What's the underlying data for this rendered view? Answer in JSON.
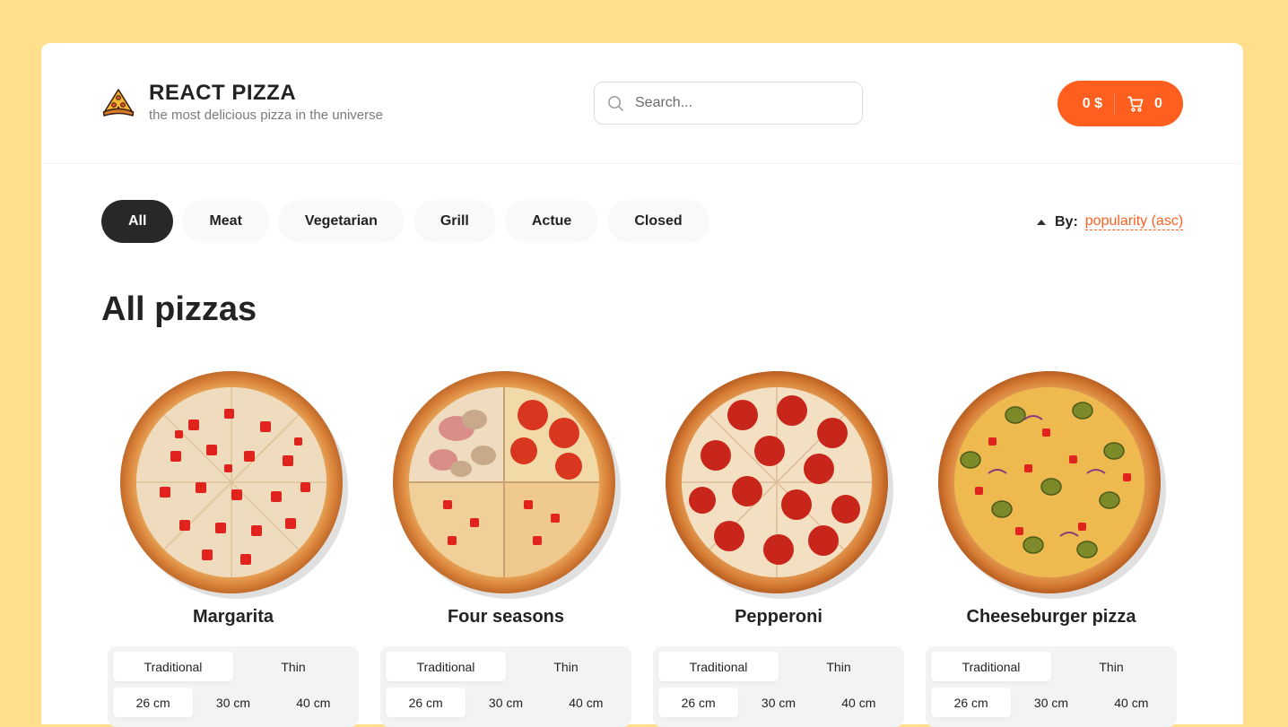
{
  "header": {
    "title": "REACT PIZZA",
    "subtitle": "the most delicious pizza in the universe",
    "search_placeholder": "Search...",
    "cart_price": "0 $",
    "cart_count": "0"
  },
  "categories": [
    "All",
    "Meat",
    "Vegetarian",
    "Grill",
    "Actue",
    "Closed"
  ],
  "active_category": "All",
  "sort": {
    "label": "By:",
    "value": "popularity (asc)"
  },
  "section_title": "All pizzas",
  "pizzas": [
    {
      "name": "Margarita",
      "types": [
        "Traditional",
        "Thin"
      ],
      "sizes": [
        "26 cm",
        "30 cm",
        "40 cm"
      ]
    },
    {
      "name": "Four seasons",
      "types": [
        "Traditional",
        "Thin"
      ],
      "sizes": [
        "26 cm",
        "30 cm",
        "40 cm"
      ]
    },
    {
      "name": "Pepperoni",
      "types": [
        "Traditional",
        "Thin"
      ],
      "sizes": [
        "26 cm",
        "30 cm",
        "40 cm"
      ]
    },
    {
      "name": "Cheeseburger pizza",
      "types": [
        "Traditional",
        "Thin"
      ],
      "sizes": [
        "26 cm",
        "30 cm",
        "40 cm"
      ]
    }
  ],
  "colors": {
    "background": "#FFDF8C",
    "accent": "#FE5F1E",
    "dark": "#282828"
  }
}
